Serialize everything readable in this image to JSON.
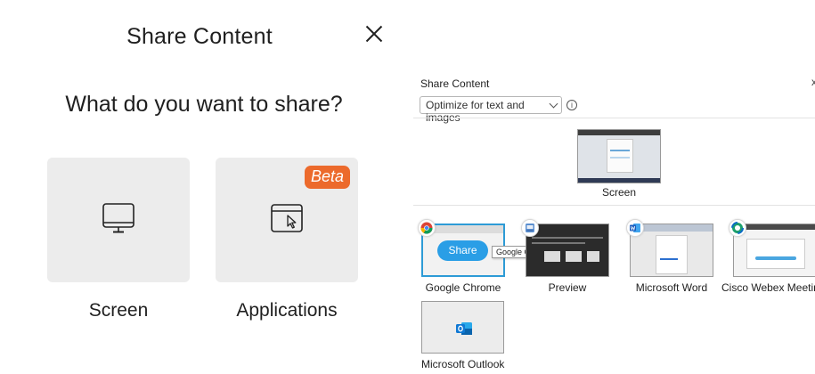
{
  "left_dialog": {
    "title": "Share Content",
    "question": "What do you want to share?",
    "options": [
      {
        "label": "Screen",
        "icon": "monitor-icon"
      },
      {
        "label": "Applications",
        "icon": "app-window-pointer-icon",
        "badge": "Beta"
      }
    ],
    "close_icon": "close-icon",
    "colors": {
      "card_bg": "#ececec",
      "beta_badge": "#ec6a2c"
    }
  },
  "right_dialog": {
    "title": "Share Content",
    "optimize_select": {
      "value": "Optimize for text and images"
    },
    "info_icon": "info-icon",
    "screen": {
      "label": "Screen"
    },
    "applications": [
      {
        "label": "Google Chrome",
        "icon": "chrome-icon",
        "selected": true
      },
      {
        "label": "Preview",
        "icon": "preview-icon"
      },
      {
        "label": "Microsoft Word",
        "icon": "word-icon"
      },
      {
        "label": "Cisco Webex Meeting",
        "icon": "webex-icon"
      },
      {
        "label": "Microsoft Outlook",
        "icon": "outlook-icon"
      }
    ],
    "share_button": "Share",
    "tooltip": "Google Chrome",
    "colors": {
      "share_button": "#2a9ee6",
      "selection_border": "#2d9bd6"
    }
  }
}
